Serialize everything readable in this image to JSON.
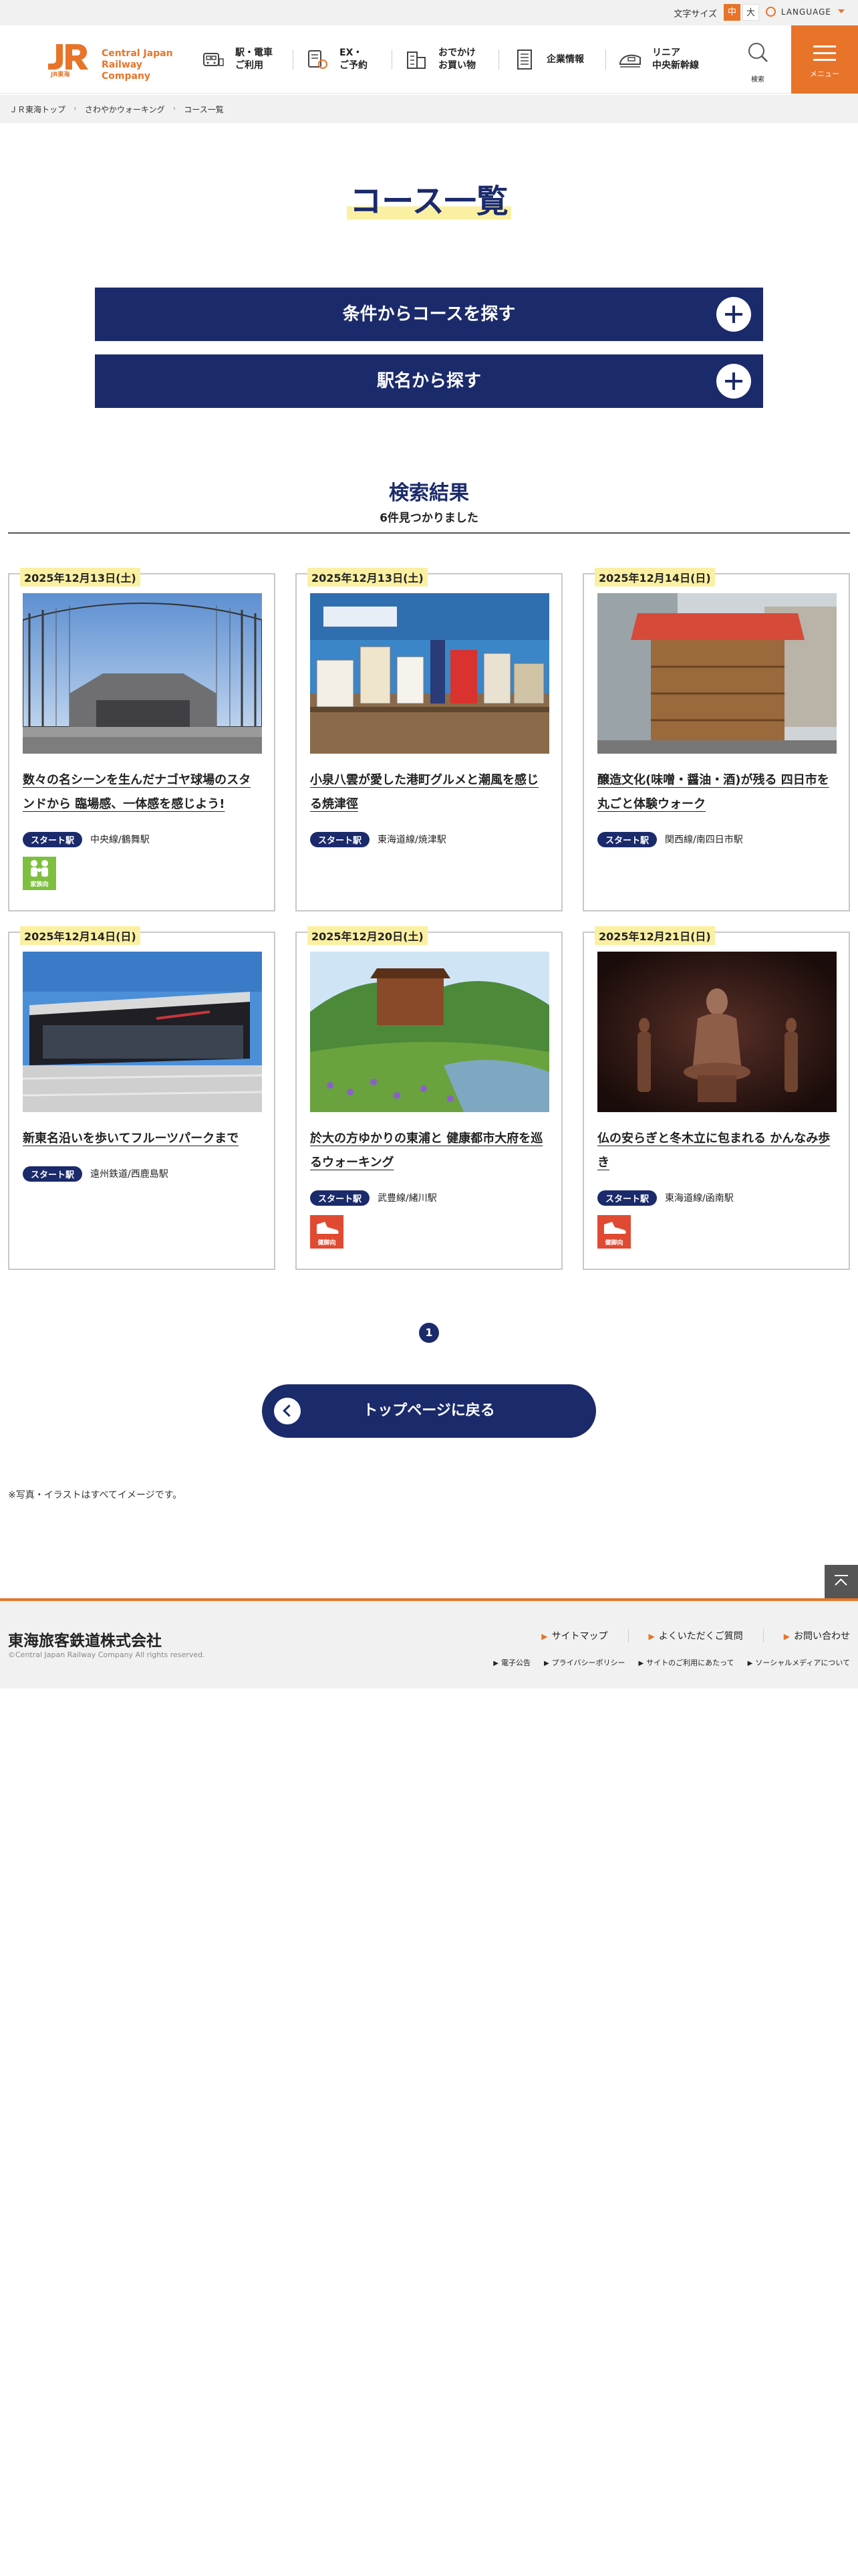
{
  "utility": {
    "font_size_label": "文字サイズ",
    "font_size_medium": "中",
    "font_size_large": "大",
    "language": "LANGUAGE"
  },
  "header": {
    "logo_mark": "JR",
    "logo_sub": "JR東海",
    "brand_line1": "Central Japan",
    "brand_line2": "Railway Company",
    "nav": [
      {
        "label": "駅・電車\nご利用"
      },
      {
        "label": "EX・\nご予約"
      },
      {
        "label": "おでかけ\nお買い物"
      },
      {
        "label": "企業情報"
      },
      {
        "label": "リニア\n中央新幹線"
      }
    ],
    "search_label": "検索",
    "menu_label": "メニュー"
  },
  "breadcrumb": [
    "ＪＲ東海トップ",
    "さわやかウォーキング",
    "コース一覧"
  ],
  "main": {
    "title": "コース一覧",
    "accordion_conditions": "条件からコースを探す",
    "accordion_station": "駅名から探す",
    "results_title": "検索結果",
    "results_count": "6件見つかりました",
    "start_tag": "スタート駅"
  },
  "courses": [
    {
      "date": "2025年12月13日(土)",
      "title": "数々の名シーンを生んだナゴヤ球場のスタンドから 臨場感、一体感を感じよう!",
      "station": "中央線/鶴舞駅",
      "badge": "家族向"
    },
    {
      "date": "2025年12月13日(土)",
      "title": "小泉八雲が愛した港町グルメと潮風を感じる焼津徑",
      "station": "東海道線/焼津駅",
      "badge": ""
    },
    {
      "date": "2025年12月14日(日)",
      "title": "醸造文化(味噌・醤油・酒)が残る 四日市を丸ごと体験ウォーク",
      "station": "関西線/南四日市駅",
      "badge": ""
    },
    {
      "date": "2025年12月14日(日)",
      "title": "新東名沿いを歩いてフルーツパークまで",
      "station": "遠州鉄道/西鹿島駅",
      "badge": ""
    },
    {
      "date": "2025年12月20日(土)",
      "title": "於大の方ゆかりの東浦と 健康都市大府を巡るウォーキング",
      "station": "武豊線/緒川駅",
      "badge": "健脚向"
    },
    {
      "date": "2025年12月21日(日)",
      "title": "仏の安らぎと冬木立に包まれる かんなみ歩き",
      "station": "東海道線/函南駅",
      "badge": "健脚向"
    }
  ],
  "pagination": {
    "current": "1"
  },
  "back_button": "トップページに戻る",
  "note": "※写真・イラストはすべてイメージです。",
  "footer": {
    "company": "東海旅客鉄道株式会社",
    "copyright": "©Central Japan Railway Company All rights reserved.",
    "links": [
      "サイトマップ",
      "よくいただくご質問",
      "お問い合わせ"
    ],
    "sublinks": [
      "電子公告",
      "プライバシーポリシー",
      "サイトのご利用にあたって",
      "ソーシャルメディアについて"
    ]
  },
  "colors": {
    "brand_orange": "#e8742a",
    "navy": "#1b2a6b",
    "highlight": "#fbf0a2",
    "family_green": "#7fbf3f",
    "health_red": "#e04a32"
  }
}
